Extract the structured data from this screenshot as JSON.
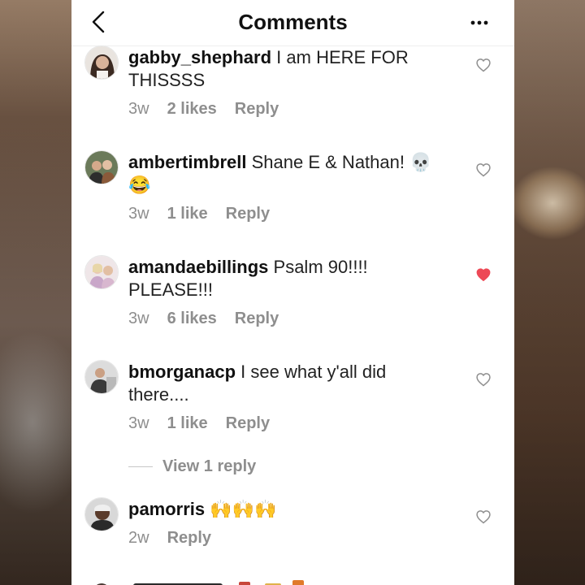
{
  "header": {
    "title": "Comments"
  },
  "comments": [
    {
      "username": "gabby_shephard",
      "text": "I am HERE FOR THISSSS",
      "time": "3w",
      "likes": "2 likes",
      "reply": "Reply",
      "liked": false
    },
    {
      "username": "ambertimbrell",
      "text": "Shane E & Nathan! 💀 😂",
      "time": "3w",
      "likes": "1 like",
      "reply": "Reply",
      "liked": false
    },
    {
      "username": "amandaebillings",
      "text": "Psalm 90!!!! PLEASE!!!",
      "time": "3w",
      "likes": "6 likes",
      "reply": "Reply",
      "liked": true
    },
    {
      "username": "bmorganacp",
      "text": "I see what y'all did there....",
      "time": "3w",
      "likes": "1 like",
      "reply": "Reply",
      "liked": false,
      "view_replies": "View 1 reply"
    },
    {
      "username": "pamorris",
      "text": "🙌🙌🙌",
      "time": "2w",
      "reply": "Reply",
      "liked": false
    }
  ],
  "colors": {
    "liked_heart": "#ed4956",
    "meta_gray": "#8e8e8e"
  }
}
